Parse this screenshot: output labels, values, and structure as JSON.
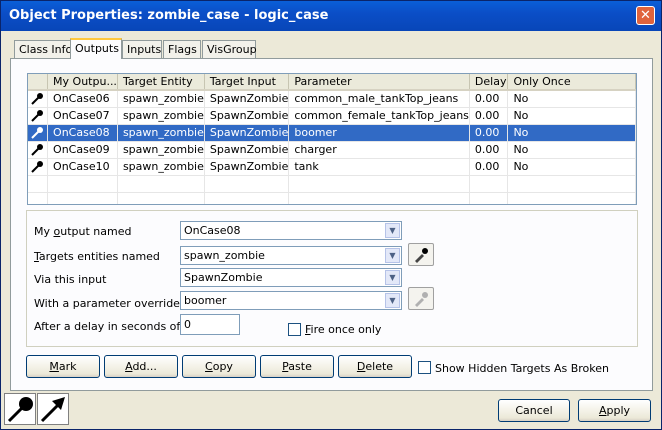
{
  "window": {
    "title": "Object Properties: zombie_case - logic_case",
    "close_glyph": "✕"
  },
  "tabs": [
    {
      "label": "Class Info",
      "active": false
    },
    {
      "label": "Outputs",
      "active": true
    },
    {
      "label": "Inputs",
      "active": false
    },
    {
      "label": "Flags",
      "active": false
    },
    {
      "label": "VisGroup",
      "active": false
    }
  ],
  "outputs_table": {
    "columns": [
      "",
      "My Outpu...",
      "Target Entity",
      "Target Input",
      "Parameter",
      "Delay",
      "Only Once"
    ],
    "rows": [
      {
        "output": "OnCase06",
        "target": "spawn_zombie",
        "input": "SpawnZombie",
        "parameter": "common_male_tankTop_jeans",
        "delay": "0.00",
        "only_once": "No",
        "selected": false
      },
      {
        "output": "OnCase07",
        "target": "spawn_zombie",
        "input": "SpawnZombie",
        "parameter": "common_female_tankTop_jeans",
        "delay": "0.00",
        "only_once": "No",
        "selected": false
      },
      {
        "output": "OnCase08",
        "target": "spawn_zombie",
        "input": "SpawnZombie",
        "parameter": "boomer",
        "delay": "0.00",
        "only_once": "No",
        "selected": true
      },
      {
        "output": "OnCase09",
        "target": "spawn_zombie",
        "input": "SpawnZombie",
        "parameter": "charger",
        "delay": "0.00",
        "only_once": "No",
        "selected": false
      },
      {
        "output": "OnCase10",
        "target": "spawn_zombie",
        "input": "SpawnZombie",
        "parameter": "tank",
        "delay": "0.00",
        "only_once": "No",
        "selected": false
      }
    ]
  },
  "form": {
    "output_label_pre": "My ",
    "output_label_ul": "o",
    "output_label_post": "utput named",
    "output_value": "OnCase08",
    "targets_label_ul": "T",
    "targets_label_post": "argets entities named",
    "targets_value": "spawn_zombie",
    "input_label": "Via this input",
    "input_value": "SpawnZombie",
    "param_label": "With a parameter override of",
    "param_value": "boomer",
    "delay_label": "After a delay in seconds of",
    "delay_value": "0",
    "fire_once_ul": "F",
    "fire_once_post": "ire once only",
    "fire_once_checked": false
  },
  "buttons": {
    "mark_ul": "M",
    "mark_post": "ark",
    "add_ul": "A",
    "add_post": "dd...",
    "copy_ul": "C",
    "copy_post": "opy",
    "paste_ul": "P",
    "paste_post": "aste",
    "delete_ul": "D",
    "delete_post": "elete",
    "show_hidden_label": "Show Hidden Targets As Broken",
    "show_hidden_checked": false,
    "cancel": "Cancel",
    "apply_ul": "A",
    "apply_post": "pply"
  },
  "icons": {
    "row_icon": "output-connection-icon",
    "picker": "eyedropper-icon",
    "status": [
      "output-ball-icon",
      "output-arrow-icon"
    ]
  },
  "colors": {
    "title_bar": "#0a5fd8",
    "selection": "#316ac5",
    "close_button": "#e0633c"
  }
}
